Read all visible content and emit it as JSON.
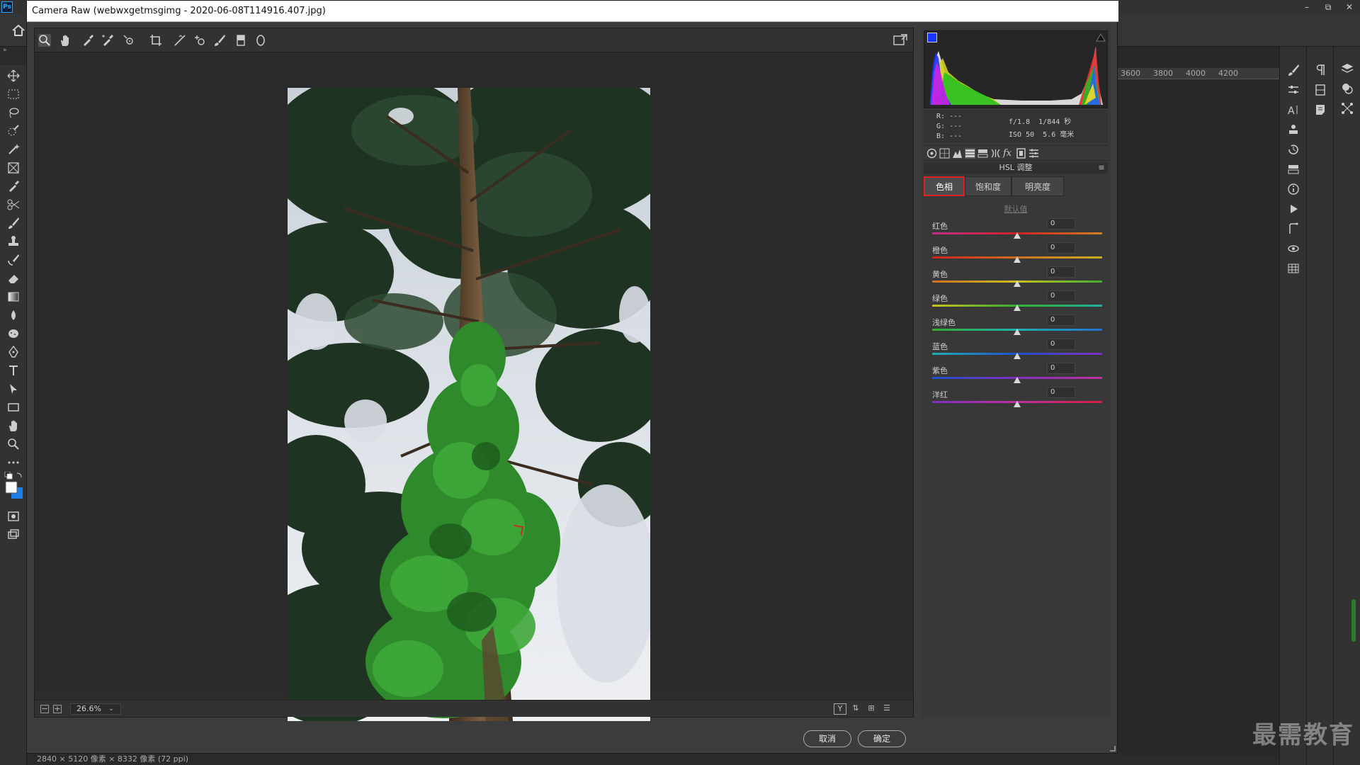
{
  "ps": {
    "logo": "Ps",
    "window_controls": [
      "–",
      "⧉",
      "✕"
    ],
    "ruler_ticks": [
      "3600",
      "3800",
      "4000",
      "4200"
    ],
    "status": "2840 × 5120 像素 × 8332 像素 (72 ppi)",
    "watermark": "最需教育"
  },
  "dialog": {
    "title": "Camera Raw (webwxgetmsgimg - 2020-06-08T114916.407.jpg)",
    "zoom_level": "26.6%",
    "view_label": "Y",
    "cancel_label": "取消",
    "ok_label": "确定"
  },
  "info": {
    "r_label": "R:",
    "g_label": "G:",
    "b_label": "B:",
    "r_value": "---",
    "g_value": "---",
    "b_value": "---",
    "aperture": "f/1.8",
    "shutter": "1/844 秒",
    "iso": "ISO 50",
    "focal_length": "5.6 毫米"
  },
  "panel": {
    "title": "HSL 调整",
    "tabs": [
      "色相",
      "饱和度",
      "明亮度"
    ],
    "default_link": "默认值",
    "sliders": [
      {
        "label": "红色",
        "value": "0",
        "gradient": "linear-gradient(90deg,#c0308a,#d02020,#d08020)"
      },
      {
        "label": "橙色",
        "value": "0",
        "gradient": "linear-gradient(90deg,#d02020,#d07020,#c8b020)"
      },
      {
        "label": "黄色",
        "value": "0",
        "gradient": "linear-gradient(90deg,#d07020,#c8c020,#40b030)"
      },
      {
        "label": "绿色",
        "value": "0",
        "gradient": "linear-gradient(90deg,#c8c020,#30b030,#20b0a0)"
      },
      {
        "label": "浅绿色",
        "value": "0",
        "gradient": "linear-gradient(90deg,#30b030,#20b0b0,#2070d0)"
      },
      {
        "label": "蓝色",
        "value": "0",
        "gradient": "linear-gradient(90deg,#20b0b0,#2050d0,#8030c0)"
      },
      {
        "label": "紫色",
        "value": "0",
        "gradient": "linear-gradient(90deg,#2050d0,#8030c0,#c030a0)"
      },
      {
        "label": "洋红",
        "value": "0",
        "gradient": "linear-gradient(90deg,#8030c0,#c030a0,#d02040)"
      }
    ]
  },
  "colors": {
    "accent_red": "#e02020",
    "ps_blue": "#31a8ff"
  }
}
